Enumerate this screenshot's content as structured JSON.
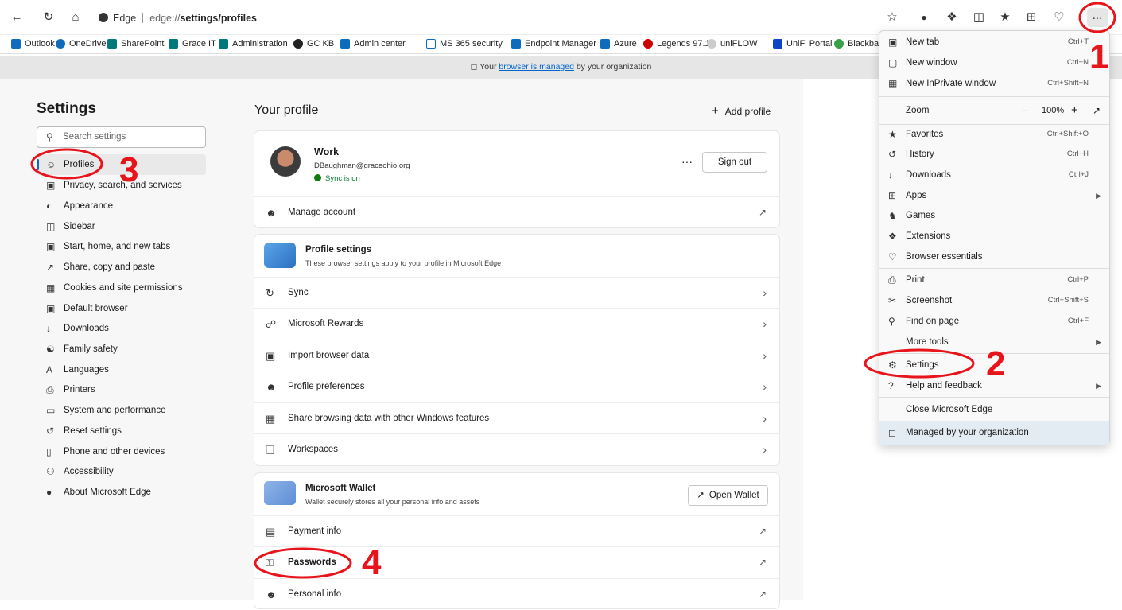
{
  "toolbar": {
    "back_icon": "back-arrow-icon",
    "address_app": "Edge",
    "address_host": "edge://",
    "address_path": "settings/profiles",
    "more_label": "..."
  },
  "bookmarks": [
    "Outlook",
    "OneDrive",
    "SharePoint",
    "Grace IT",
    "Administration",
    "GC KB",
    "Admin center",
    "MS 365 security",
    "Endpoint Manager",
    "Azure",
    "Legends 97.1",
    "uniFLOW",
    "UniFi Portal",
    "Blackba"
  ],
  "managed_bar": {
    "prefix": "Your ",
    "link": "browser is managed",
    "suffix": " by your organization"
  },
  "sidebar": {
    "title": "Settings",
    "search_placeholder": "Search settings",
    "items": [
      {
        "label": "Profiles"
      },
      {
        "label": "Privacy, search, and services"
      },
      {
        "label": "Appearance"
      },
      {
        "label": "Sidebar"
      },
      {
        "label": "Start, home, and new tabs"
      },
      {
        "label": "Share, copy and paste"
      },
      {
        "label": "Cookies and site permissions"
      },
      {
        "label": "Default browser"
      },
      {
        "label": "Downloads"
      },
      {
        "label": "Family safety"
      },
      {
        "label": "Languages"
      },
      {
        "label": "Printers"
      },
      {
        "label": "System and performance"
      },
      {
        "label": "Reset settings"
      },
      {
        "label": "Phone and other devices"
      },
      {
        "label": "Accessibility"
      },
      {
        "label": "About Microsoft Edge"
      }
    ]
  },
  "main": {
    "title": "Your profile",
    "add_profile": "Add profile",
    "profile": {
      "name": "Work",
      "email": "DBaughman@graceohio.org",
      "sync_status": "Sync is on",
      "more": "···",
      "sign_out": "Sign out",
      "manage_account": "Manage account"
    },
    "profile_settings": {
      "title": "Profile settings",
      "subtitle": "These browser settings apply to your profile in Microsoft Edge",
      "rows": [
        "Sync",
        "Microsoft Rewards",
        "Import browser data",
        "Profile preferences",
        "Share browsing data with other Windows features",
        "Workspaces"
      ]
    },
    "wallet": {
      "title": "Microsoft Wallet",
      "subtitle": "Wallet securely stores all your personal info and assets",
      "open_wallet": "Open Wallet",
      "rows": [
        "Payment info",
        "Passwords",
        "Personal info"
      ]
    }
  },
  "menu": {
    "items": [
      {
        "label": "New tab",
        "shortcut": "Ctrl+T"
      },
      {
        "label": "New window",
        "shortcut": "Ctrl+N"
      },
      {
        "label": "New InPrivate window",
        "shortcut": "Ctrl+Shift+N"
      },
      {
        "label": "Zoom",
        "value": "100%"
      },
      {
        "label": "Favorites",
        "shortcut": "Ctrl+Shift+O"
      },
      {
        "label": "History",
        "shortcut": "Ctrl+H"
      },
      {
        "label": "Downloads",
        "shortcut": "Ctrl+J"
      },
      {
        "label": "Apps"
      },
      {
        "label": "Games"
      },
      {
        "label": "Extensions"
      },
      {
        "label": "Browser essentials"
      },
      {
        "label": "Print",
        "shortcut": "Ctrl+P"
      },
      {
        "label": "Screenshot",
        "shortcut": "Ctrl+Shift+S"
      },
      {
        "label": "Find on page",
        "shortcut": "Ctrl+F"
      },
      {
        "label": "More tools"
      },
      {
        "label": "Settings"
      },
      {
        "label": "Help and feedback"
      },
      {
        "label": "Close Microsoft Edge"
      },
      {
        "label": "Managed by your organization"
      }
    ]
  },
  "annotations": {
    "step1": "1",
    "step2": "2",
    "step3": "3",
    "step4": "4",
    "color": "#e8141b"
  }
}
